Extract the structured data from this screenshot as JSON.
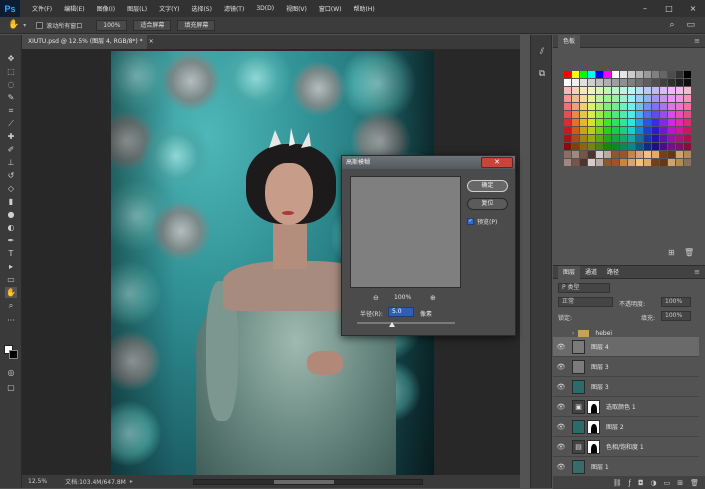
{
  "app": {
    "logo": "Ps"
  },
  "menu": [
    "文件(F)",
    "编辑(E)",
    "图像(I)",
    "图层(L)",
    "文字(Y)",
    "选择(S)",
    "滤镜(T)",
    "3D(D)",
    "视图(V)",
    "窗口(W)",
    "帮助(H)"
  ],
  "options_bar": {
    "scroll_all": "滚动所有窗口",
    "zoom": "100%",
    "fit_screen": "适合屏幕",
    "fill_screen": "填充屏幕"
  },
  "document": {
    "tab_title": "XIUTU.psd @ 12.5% (图层 4, RGB/8*) *"
  },
  "status": {
    "zoom": "12.5%",
    "doc_size": "文档:103.4M/647.8M"
  },
  "swatches": {
    "tab": "色板"
  },
  "layers": {
    "tabs": [
      "图层",
      "通道",
      "路径"
    ],
    "kind_label": "P 类型",
    "blend_mode": "正常",
    "opacity_label": "不透明度:",
    "opacity": "100%",
    "fill_label": "填充:",
    "fill": "100%",
    "lock_label": "锁定:",
    "rows": [
      {
        "name": "hebei",
        "group": true
      },
      {
        "name": "图层 4",
        "selected": true
      },
      {
        "name": "图层 3"
      },
      {
        "name": "图层 3"
      },
      {
        "name": "选取颜色 1",
        "adjust": true
      },
      {
        "name": "图层 2"
      },
      {
        "name": "色相/饱和度 1",
        "adjust": true
      },
      {
        "name": "图层 1"
      }
    ]
  },
  "dialog": {
    "title": "高斯模糊",
    "ok": "确定",
    "reset": "复位",
    "preview": "预览(P)",
    "zoom": "100%",
    "radius_label": "半径(R):",
    "radius_value": "5.0",
    "radius_unit": "像素"
  }
}
